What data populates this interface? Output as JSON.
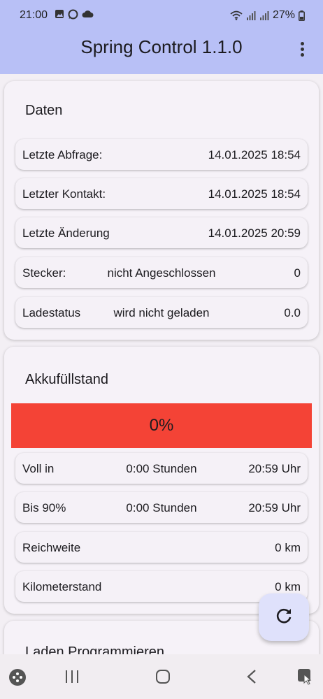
{
  "status": {
    "time": "21:00",
    "battery": "27%"
  },
  "appbar": {
    "title": "Spring Control 1.1.0",
    "menu_icon": "more-vert-icon"
  },
  "daten": {
    "title": "Daten",
    "rows": [
      {
        "label": "Letzte Abfrage:",
        "center": "",
        "value": "14.01.2025 18:54"
      },
      {
        "label": "Letzter Kontakt:",
        "center": "",
        "value": "14.01.2025 18:54"
      },
      {
        "label": "Letzte Änderung",
        "center": "",
        "value": "14.01.2025 20:59"
      },
      {
        "label": "Stecker:",
        "center": "nicht Angeschlossen",
        "value": "0"
      },
      {
        "label": "Ladestatus",
        "center": "wird nicht geladen",
        "value": "0.0"
      }
    ]
  },
  "akku": {
    "title": "Akkufüllstand",
    "level_text": "0%",
    "level_fraction": 0,
    "bar_color": "#f44336",
    "rows": [
      {
        "label": "Voll in",
        "center": "0:00 Stunden",
        "value": "20:59 Uhr"
      },
      {
        "label": "Bis 90%",
        "center": "0:00 Stunden",
        "value": "20:59 Uhr"
      },
      {
        "label": "Reichweite",
        "center": "",
        "value": "0 km"
      },
      {
        "label": "Kilometerstand",
        "center": "",
        "value": "0 km"
      }
    ]
  },
  "laden": {
    "title": "Laden Programmieren"
  },
  "fab": {
    "icon": "refresh-icon"
  },
  "colors": {
    "appbar": "#b8c0f6",
    "background": "#f3eff4",
    "fab": "#dfe1fb"
  }
}
